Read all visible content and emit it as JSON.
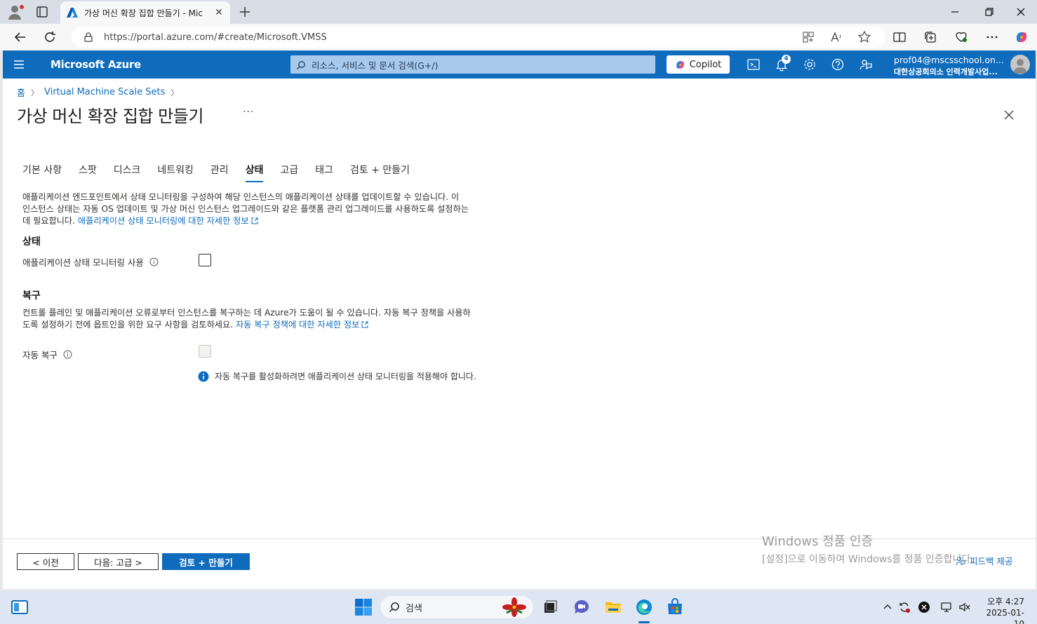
{
  "browser": {
    "tab_title": "가상 머신 확장 집합 만들기 - Mic",
    "url": "https://portal.azure.com/#create/Microsoft.VMSS"
  },
  "portal": {
    "brand": "Microsoft Azure",
    "search_placeholder": "리소스, 서비스 및 문서 검색(G+/)",
    "copilot_label": "Copilot",
    "notification_count": "4",
    "account_email": "prof04@mscsschool.on...",
    "account_org": "대한상공회의소 인력개발사업..."
  },
  "breadcrumb": {
    "home": "홈",
    "item": "Virtual Machine Scale Sets"
  },
  "page_title": "가상 머신 확장 집합 만들기",
  "more": "···",
  "tabs": [
    "기본 사항",
    "스팟",
    "디스크",
    "네트워킹",
    "관리",
    "상태",
    "고급",
    "태그",
    "검토 + 만들기"
  ],
  "active_tab": "상태",
  "health": {
    "desc_line1": "애플리케이션 엔드포인트에서 상태 모니터링을 구성하여 해당 인스턴스의 애플리케이션 상태를 업데이트할 수 있습니다. 이",
    "desc_line2": "인스턴스 상태는 자동 OS 업데이트 및 가상 머신 인스턴스 업그레이드와 같은 플랫폼 관리 업그레이드를 사용하도록 설정하는",
    "desc_line3": "데 필요합니다.",
    "desc_link": "애플리케이션 상태 모니터링에 대한 자세한 정보",
    "section": "상태",
    "field_label": "애플리케이션 상태 모니터링 사용",
    "checked": false
  },
  "repair": {
    "section": "복구",
    "desc_line1": "컨트롤 플레인 및 애플리케이션 오류로부터 인스턴스를 복구하는 데 Azure가 도움이 될 수 있습니다. 자동 복구 정책을 사용하",
    "desc_line2": "도록 설정하기 전에 옵트인을 위한 요구 사항을 검토하세요.",
    "desc_link": "자동 복구 정책에 대한 자세한 정보",
    "field_label": "자동 복구",
    "checked": false,
    "info_message": "자동 복구를 활성화하려면 애플리케이션 상태 모니터링을 적용해야 합니다."
  },
  "footer": {
    "prev": "< 이전",
    "next": "다음: 고급 >",
    "review": "검토 + 만들기",
    "feedback": "피드백 제공"
  },
  "watermark": {
    "line1": "Windows 정품 인증",
    "line2": "[설정]으로 이동하여 Windows를 정품 인증합니다."
  },
  "taskbar": {
    "search": "검색",
    "time": "오후 4:27",
    "date": "2025-01-10"
  },
  "colors": {
    "azure_blue": "#0f6cbd",
    "link": "#0f6cbd"
  }
}
